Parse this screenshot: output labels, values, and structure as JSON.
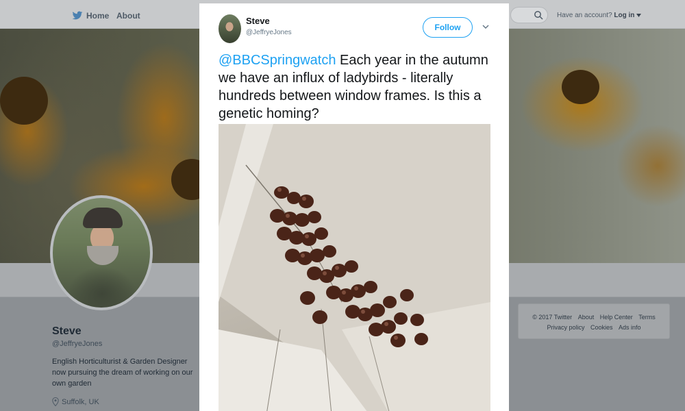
{
  "nav": {
    "home": "Home",
    "about": "About"
  },
  "account": {
    "prompt": "Have an account?",
    "login": "Log in"
  },
  "profile": {
    "name": "Steve",
    "handle": "@JeffryeJones",
    "bio": "English Horticulturist & Garden Designer now pursuing the dream of working on our own garden",
    "location": "Suffolk, UK"
  },
  "footer": {
    "copyright": "© 2017 Twitter",
    "about": "About",
    "help": "Help Center",
    "terms": "Terms",
    "privacy": "Privacy policy",
    "cookies": "Cookies",
    "ads": "Ads info"
  },
  "tweet": {
    "name": "Steve",
    "handle": "@JeffryeJones",
    "follow_label": "Follow",
    "mention": "@BBCSpringwatch",
    "text": " Each year in the autumn we have an influx of ladybirds - literally hundreds between window frames. Is this a genetic homing?"
  },
  "colors": {
    "accent": "#1da1f2",
    "text": "#14171a",
    "muted": "#657786"
  },
  "icons": {
    "logo": "twitter-bird-icon",
    "search": "search-icon",
    "caret": "chevron-down-icon",
    "location": "location-pin-icon"
  }
}
